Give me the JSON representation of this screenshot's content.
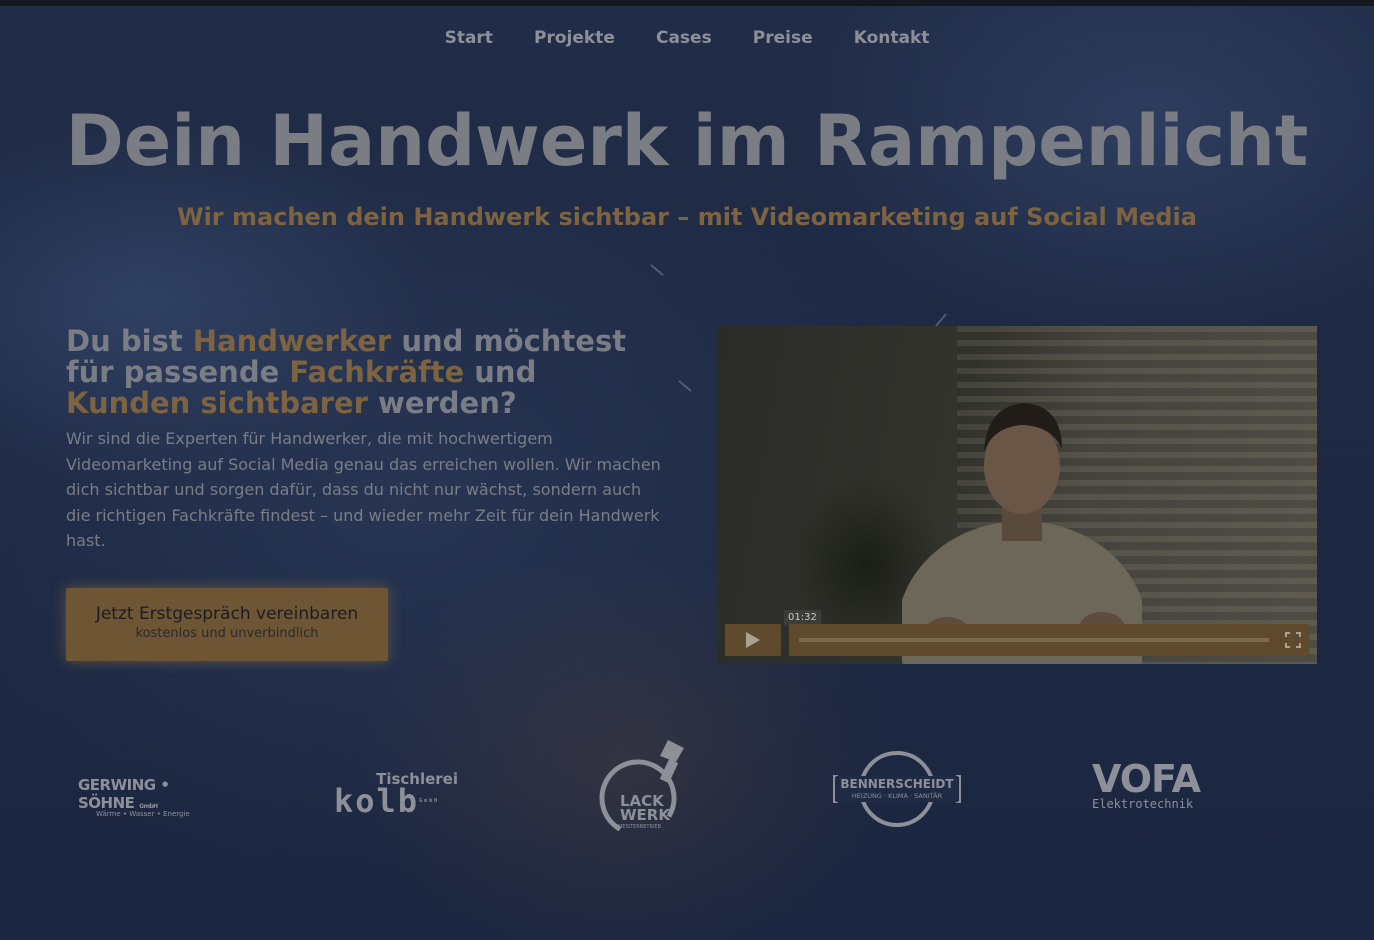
{
  "nav": {
    "items": [
      {
        "label": "Start"
      },
      {
        "label": "Projekte"
      },
      {
        "label": "Cases"
      },
      {
        "label": "Preise"
      },
      {
        "label": "Kontakt"
      }
    ]
  },
  "hero": {
    "title": "Dein Handwerk im Rampenlicht",
    "subtitle": "Wir machen dein Handwerk sichtbar – mit Videomarketing auf Social Media"
  },
  "intro": {
    "lead_parts": [
      "Du bist ",
      "Handwerker",
      " und möchtest für passende ",
      "Fachkräfte",
      " und ",
      "Kunden sichtbarer",
      " werden?"
    ],
    "description": "Wir sind die Experten für Handwerker, die mit hochwertigem Videomarketing auf Social Media genau das erreichen wollen. Wir machen dich sichtbar und sorgen dafür, dass du nicht nur wächst, sondern auch die richtigen Fachkräfte findest – und wieder mehr Zeit für dein Handwerk hast.",
    "cta_label": "Jetzt Erstgespräch vereinbaren",
    "cta_sublabel": "kostenlos und unverbindlich"
  },
  "video": {
    "duration": "01:32",
    "play_icon": "play-icon",
    "fullscreen_icon": "fullscreen-icon"
  },
  "logos": {
    "gerwing_name": "GERWING • SÖHNE",
    "gerwing_suffix": "GmbH",
    "gerwing_tagline": "Wärme • Wasser • Energie",
    "kolb_top": "Tischlerei",
    "kolb_name": "kolb",
    "kolb_suffix": "GmbH",
    "lackwerk_line1": "LACK",
    "lackwerk_line2": "WERK",
    "lackwerk_tagline": "MEISTERBETRIEB",
    "benner_name": "BENNERSCHEIDT",
    "benner_tagline": "HEIZUNG · KLIMA · SANITÄR",
    "vofa_name": "VOFA",
    "vofa_tagline": "Elektrotechnik"
  },
  "colors": {
    "accent": "#7d6340",
    "background": "#1f2a44",
    "text_muted": "#7a7d85"
  }
}
